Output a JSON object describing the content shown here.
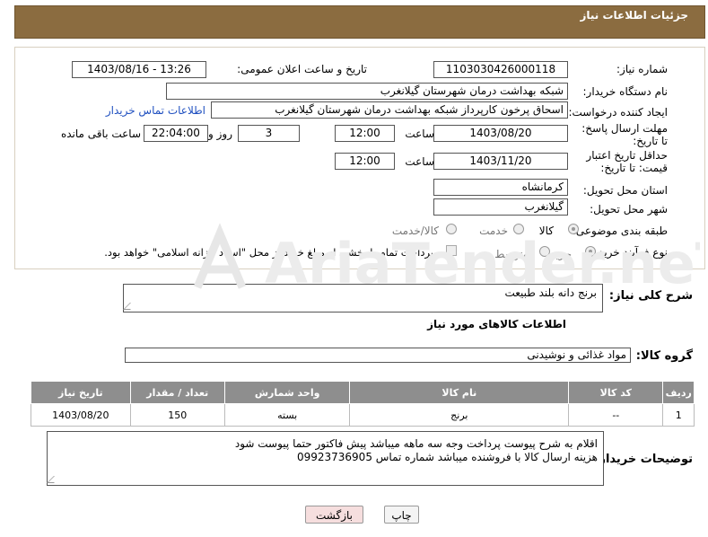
{
  "header": {
    "title": "جزئیات اطلاعات نیاز"
  },
  "form": {
    "need_number_label": "شماره نیاز:",
    "need_number": "1103030426000118",
    "announce_label": "تاریخ و ساعت اعلان عمومی:",
    "announce_value": "1403/08/16 - 13:26",
    "buyer_org_label": "نام دستگاه خریدار:",
    "buyer_org": "شبکه بهداشت درمان شهرستان گیلانغرب",
    "creator_label": "ایجاد کننده درخواست:",
    "creator": "اسحاق پرخون کارپرداز شبکه بهداشت درمان شهرستان گیلانغرب",
    "contact_link": "اطلاعات تماس خریدار",
    "reply_deadline_label": "مهلت ارسال پاسخ: تا تاریخ:",
    "reply_date": "1403/08/20",
    "time_label": "ساعت",
    "reply_time": "12:00",
    "days_value": "3",
    "days_label": "روز و",
    "remaining_time": "22:04:00",
    "remaining_label": "ساعت باقی مانده",
    "price_deadline_label": "حداقل تاریخ اعتبار قیمت: تا تاریخ:",
    "price_date": "1403/11/20",
    "price_time": "12:00",
    "province_label": "استان محل تحویل:",
    "province": "کرمانشاه",
    "city_label": "شهر محل تحویل:",
    "city": "گیلانغرب",
    "category_label": "طبقه بندی موضوعی:",
    "category_goods": "کالا",
    "category_service": "خدمت",
    "category_both": "کالا/خدمت",
    "process_label": "نوع فرآیند خرید :",
    "process_partial": "جزیی",
    "process_medium": "متوسط",
    "payment_note": "پرداخت تمام یا بخشی از مبلغ خرید،از محل \"اسناد خزانه اسلامی\" خواهد بود."
  },
  "summary": {
    "label": "شرح کلی نیاز:",
    "value": "برنج دانه بلند طبیعت"
  },
  "goods_section": {
    "title": "اطلاعات کالاهای مورد نیاز",
    "group_label": "گروه کالا:",
    "group_value": "مواد غذائی و نوشیدنی"
  },
  "table": {
    "headers": [
      "ردیف",
      "کد کالا",
      "نام کالا",
      "واحد شمارش",
      "تعداد / مقدار",
      "تاریخ نیاز"
    ],
    "rows": [
      [
        "1",
        "--",
        "برنج",
        "بسته",
        "150",
        "1403/08/20"
      ]
    ]
  },
  "buyer_notes": {
    "label": "توضیحات خریدار:",
    "line1": "اقلام به شرح پیوست پرداخت وجه سه ماهه میباشد پیش فاکتور حتما پیوست شود",
    "line2": "هزینه ارسال کالا با فروشنده میباشد شماره تماس 09923736905"
  },
  "buttons": {
    "print": "چاپ",
    "back": "بازگشت"
  },
  "watermark": {
    "text": "AriaTender.neT"
  },
  "colors": {
    "header_bg": "#8b6c40",
    "table_header": "#8e8e8e",
    "link": "#2050c0",
    "back_button": "#f6dede"
  }
}
